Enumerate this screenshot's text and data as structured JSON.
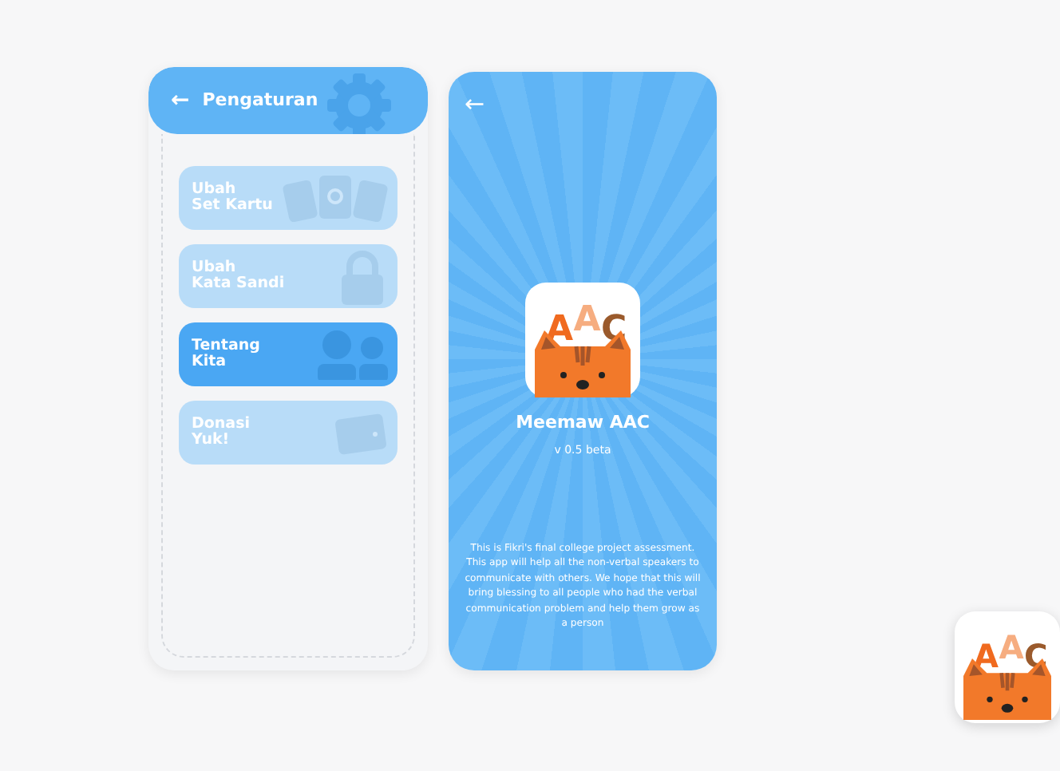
{
  "settings_screen": {
    "back_icon": "←",
    "title": "Pengaturan",
    "menu_items": [
      {
        "label": "Ubah\nSet Kartu",
        "selected": false
      },
      {
        "label": "Ubah\nKata Sandi",
        "selected": false
      },
      {
        "label": "Tentang\nKita",
        "selected": true
      },
      {
        "label": "Donasi\nYuk!",
        "selected": false
      }
    ]
  },
  "about_screen": {
    "back_icon": "←",
    "logo_letters": "AAC",
    "app_name": "Meemaw AAC",
    "version": "v 0.5 beta",
    "description": "This is Fikri's final college project assessment. This app will help all the non-verbal speakers to communicate with others. We hope that this will bring blessing to all people who had the verbal communication problem and help them grow as a person"
  },
  "corner_icon": {
    "logo_letters": "AAC"
  }
}
